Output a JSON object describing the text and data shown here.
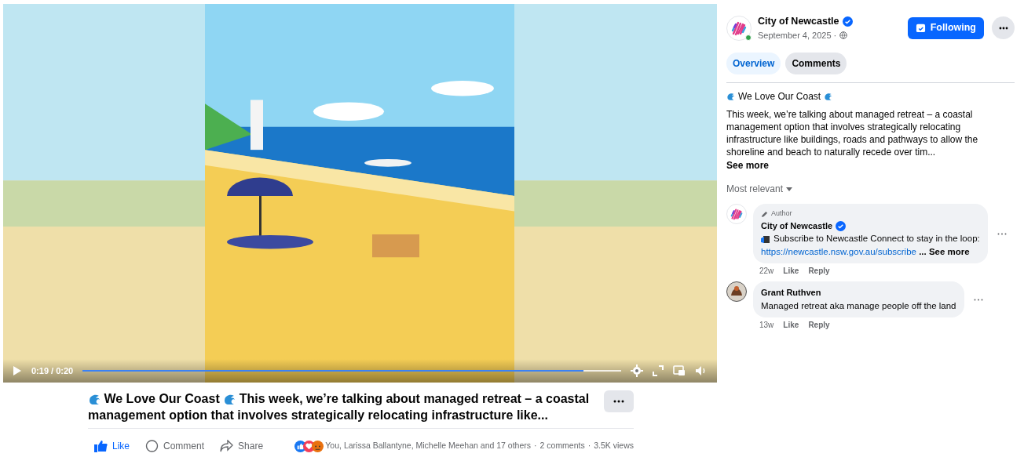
{
  "video": {
    "kind": "picture",
    "time": "0:19 / 0:20",
    "progress": {
      "level": 0.93
    }
  },
  "post": {
    "title": "We Love Our Coast",
    "text": "This week, we’re talking about managed retreat – a coastal management option that involves strategically relocating infrastructure like...",
    "actions": [
      {
        "kind": "like",
        "label": "Like",
        "selected": true
      },
      {
        "kind": "comment",
        "label": "Comment",
        "selected": false
      },
      {
        "kind": "share",
        "label": "Share",
        "selected": false
      }
    ],
    "reactions": "You, Larissa Ballantyne, Michelle Meehan and 17 others",
    "separator": "·",
    "comments_count": "2 comments",
    "views": "3.5K views"
  },
  "sidebar": {
    "page_name": "City of Newcastle",
    "verified": true,
    "online": true,
    "date": "September 4, 2025 ·",
    "follow_button": "Following",
    "tabs": [
      {
        "label": "Overview",
        "selected": true
      },
      {
        "label": "Comments",
        "selected": false
      }
    ],
    "description": {
      "heading": "We Love Our Coast",
      "body": "This week, we’re talking about managed retreat – a coastal management option that involves strategically relocating infrastructure like buildings, roads and pathways to allow the shoreline and beach to naturally recede over tim...",
      "see_more": "See more"
    },
    "sort": "Most relevant",
    "comments": [
      {
        "kind": "logo",
        "badge": "Author",
        "author": "City of Newcastle",
        "verified": true,
        "text": "Subscribe to Newcastle Connect to stay in the loop:",
        "link": "https://newcastle.nsw.gov.au/subscribe",
        "see_more": "... See more",
        "time": "22w",
        "like": "Like",
        "reply": "Reply"
      },
      {
        "kind": "person",
        "author": "Grant Ruthven",
        "verified": false,
        "text": "Managed retreat aka manage people off the land",
        "time": "13w",
        "like": "Like",
        "reply": "Reply"
      }
    ]
  }
}
